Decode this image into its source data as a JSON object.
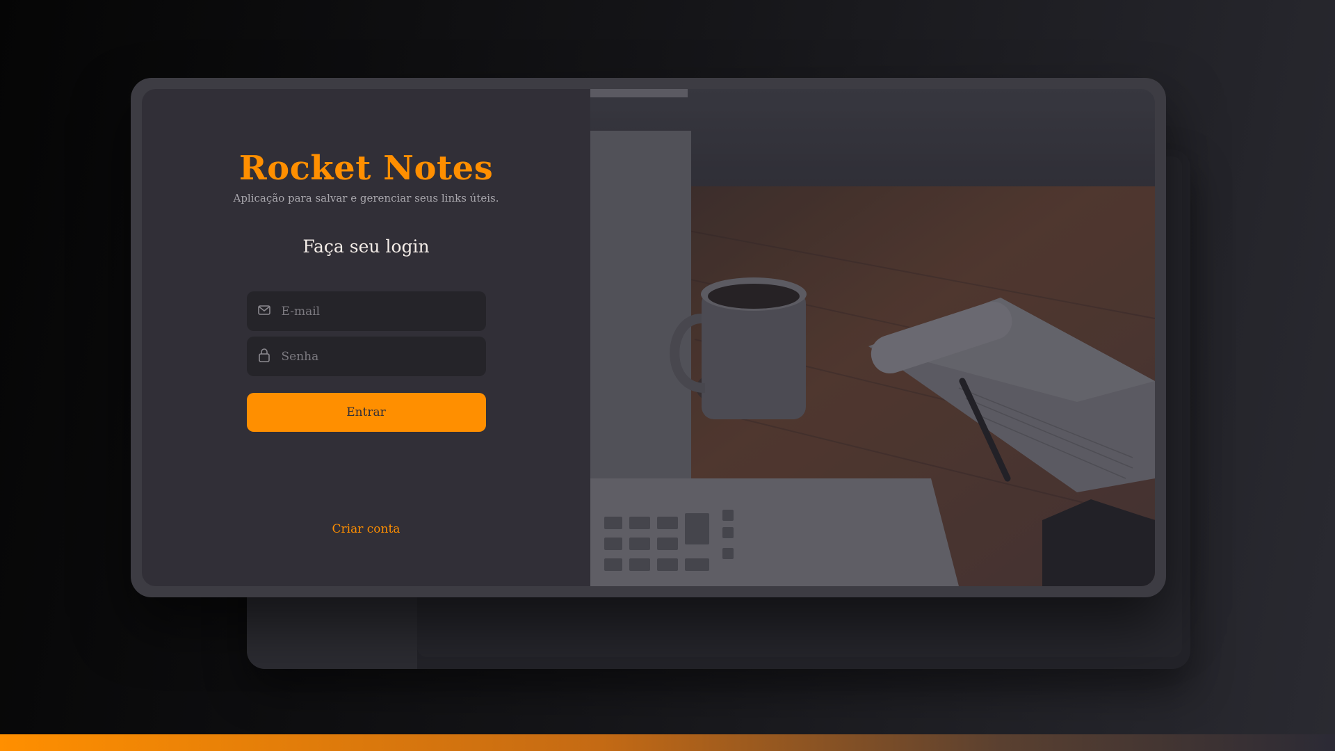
{
  "app": {
    "title": "Rocket Notes",
    "subtitle": "Aplicação para salvar e gerenciar seus links úteis."
  },
  "form": {
    "heading": "Faça seu login",
    "email_placeholder": "E-mail",
    "email_icon": "mail-icon",
    "password_placeholder": "Senha",
    "password_icon": "lock-icon",
    "submit_label": "Entrar",
    "create_account_label": "Criar conta"
  },
  "colors": {
    "accent": "#ff8f00",
    "panel": "#312f37",
    "input_bg": "#252429",
    "text_light": "#f4ede8",
    "placeholder": "#7c7a80"
  },
  "photo": {
    "description_icon": "workspace-image"
  }
}
